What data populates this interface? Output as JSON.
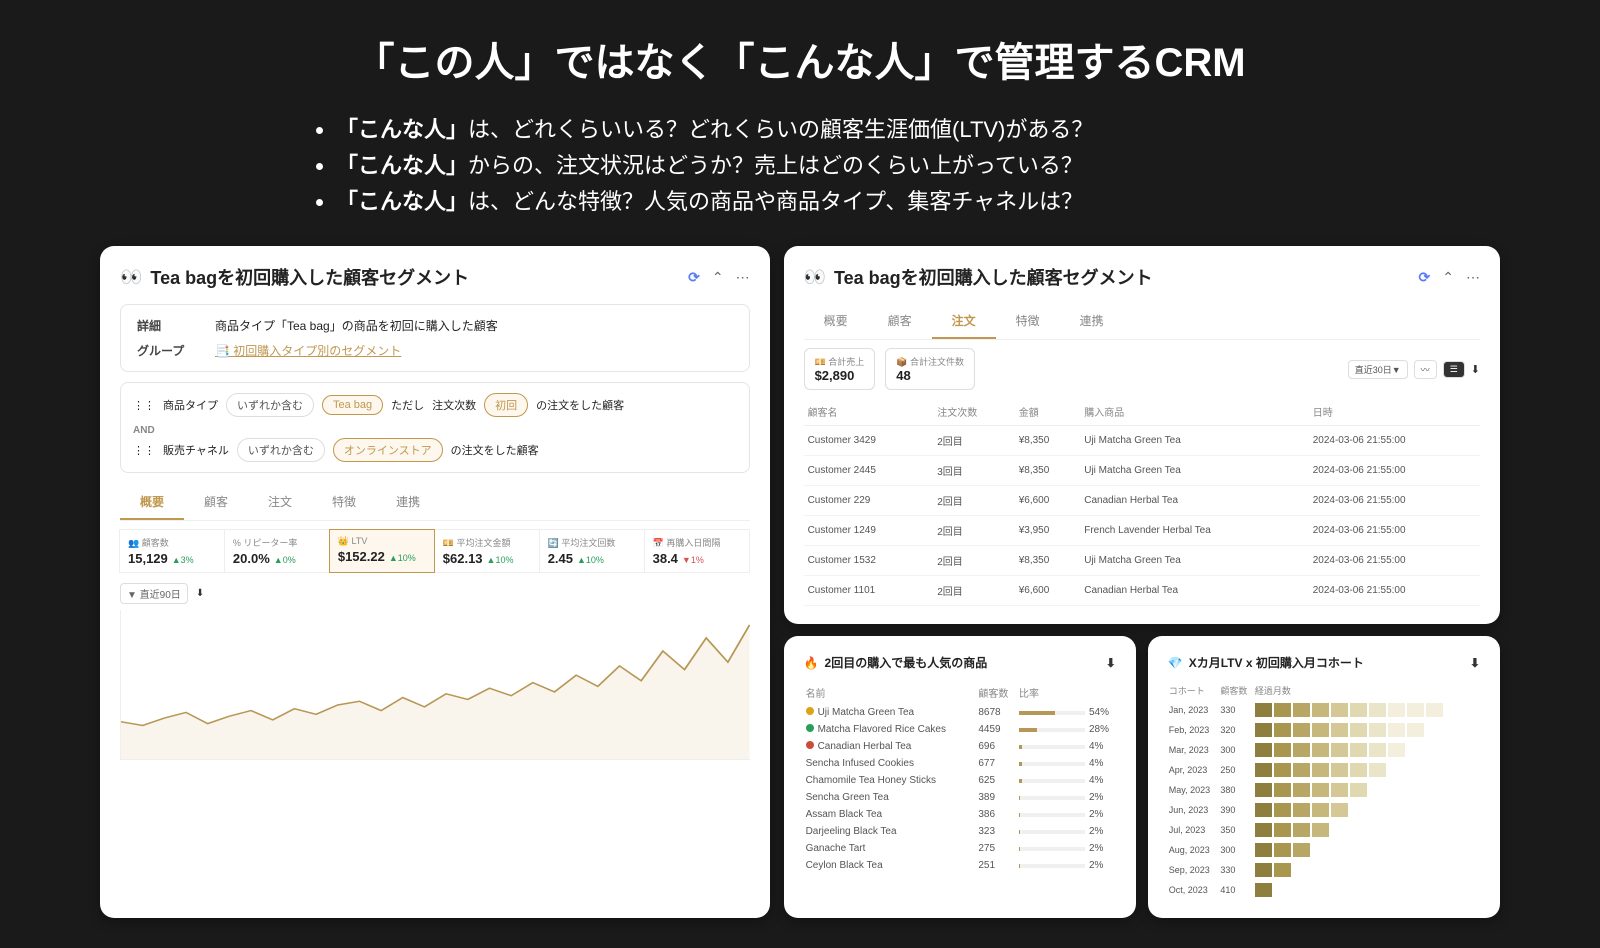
{
  "headline": "「この人」ではなく「こんな人」で管理するCRM",
  "bullets": [
    {
      "bold": "「こんな人」",
      "rest": "は、どれくらいいる？どれくらいの顧客生涯価値(LTV)がある？"
    },
    {
      "bold": "「こんな人」",
      "rest": "からの、注文状況はどうか？売上はどのくらい上がっている？"
    },
    {
      "bold": "「こんな人」",
      "rest": "は、どんな特徴？人気の商品や商品タイプ、集客チャネルは？"
    }
  ],
  "left_card": {
    "title": "Tea bagを初回購入した顧客セグメント",
    "detail_label": "詳細",
    "detail_text": "商品タイプ「Tea bag」の商品を初回に購入した顧客",
    "group_label": "グループ",
    "group_link": "📑 初回購入タイプ別のセグメント",
    "filter1": {
      "pre": "商品タイプ",
      "cond": "いずれか含む",
      "tag": "Tea bag",
      "mid": "ただし",
      "cond2": "注文次数",
      "tag2": "初回",
      "post": "の注文をした顧客"
    },
    "and": "AND",
    "filter2": {
      "pre": "販売チャネル",
      "cond": "いずれか含む",
      "tag": "オンラインストア",
      "post": "の注文をした顧客"
    },
    "tabs": [
      "概要",
      "顧客",
      "注文",
      "特徴",
      "連携"
    ],
    "stats": [
      {
        "label": "👥 顧客数",
        "val": "15,129",
        "delta": "▲3%",
        "cls": "up"
      },
      {
        "label": "% リピーター率",
        "val": "20.0%",
        "delta": "▲0%",
        "cls": "up"
      },
      {
        "label": "👑 LTV",
        "val": "$152.22",
        "delta": "▲10%",
        "cls": "up",
        "hl": true
      },
      {
        "label": "💴 平均注文金額",
        "val": "$62.13",
        "delta": "▲10%",
        "cls": "up"
      },
      {
        "label": "🔄 平均注文回数",
        "val": "2.45",
        "delta": "▲10%",
        "cls": "up"
      },
      {
        "label": "📅 再購入日間隔",
        "val": "38.4",
        "delta": "▼1%",
        "cls": "down"
      }
    ],
    "period": "▼ 直近90日"
  },
  "right_top": {
    "title": "Tea bagを初回購入した顧客セグメント",
    "tabs": [
      "概要",
      "顧客",
      "注文",
      "特徴",
      "連携"
    ],
    "sum1_label": "💴 合計売上",
    "sum1_val": "$2,890",
    "sum2_label": "📦 合計注文件数",
    "sum2_val": "48",
    "period": "直近30日▼",
    "cols": [
      "顧客名",
      "注文次数",
      "金額",
      "購入商品",
      "日時"
    ],
    "rows": [
      [
        "Customer 3429",
        "2回目",
        "¥8,350",
        "Uji Matcha Green Tea",
        "2024-03-06 21:55:00"
      ],
      [
        "Customer 2445",
        "3回目",
        "¥8,350",
        "Uji Matcha Green Tea",
        "2024-03-06 21:55:00"
      ],
      [
        "Customer 229",
        "2回目",
        "¥6,600",
        "Canadian Herbal Tea",
        "2024-03-06 21:55:00"
      ],
      [
        "Customer 1249",
        "2回目",
        "¥3,950",
        "French Lavender Herbal Tea",
        "2024-03-06 21:55:00"
      ],
      [
        "Customer 1532",
        "2回目",
        "¥8,350",
        "Uji Matcha Green Tea",
        "2024-03-06 21:55:00"
      ],
      [
        "Customer 1101",
        "2回目",
        "¥6,600",
        "Canadian Herbal Tea",
        "2024-03-06 21:55:00"
      ]
    ]
  },
  "popular": {
    "title": "2回目の購入で最も人気の商品",
    "cols": [
      "名前",
      "顧客数",
      "比率",
      ""
    ],
    "rows": [
      {
        "dot": "#d9a516",
        "name": "Uji Matcha Green Tea",
        "cnt": "8678",
        "pct": "54%",
        "w": 54
      },
      {
        "dot": "#2a9d5a",
        "name": "Matcha Flavored Rice Cakes",
        "cnt": "4459",
        "pct": "28%",
        "w": 28
      },
      {
        "dot": "#c94d3a",
        "name": "Canadian Herbal Tea",
        "cnt": "696",
        "pct": "4%",
        "w": 4
      },
      {
        "name": "Sencha Infused Cookies",
        "cnt": "677",
        "pct": "4%",
        "w": 4
      },
      {
        "name": "Chamomile Tea Honey Sticks",
        "cnt": "625",
        "pct": "4%",
        "w": 4
      },
      {
        "name": "Sencha Green Tea",
        "cnt": "389",
        "pct": "2%",
        "w": 2
      },
      {
        "name": "Assam Black Tea",
        "cnt": "386",
        "pct": "2%",
        "w": 2
      },
      {
        "name": "Darjeeling Black Tea",
        "cnt": "323",
        "pct": "2%",
        "w": 2
      },
      {
        "name": "Ganache Tart",
        "cnt": "275",
        "pct": "2%",
        "w": 2
      },
      {
        "name": "Ceylon Black Tea",
        "cnt": "251",
        "pct": "2%",
        "w": 2
      }
    ]
  },
  "cohort": {
    "title": "Xカ月LTV x 初回購入月コホート",
    "cols": [
      "コホート",
      "顧客数",
      "経過月数"
    ],
    "rows": [
      {
        "m": "Jan, 2023",
        "c": "330",
        "cells": 10
      },
      {
        "m": "Feb, 2023",
        "c": "320",
        "cells": 9
      },
      {
        "m": "Mar, 2023",
        "c": "300",
        "cells": 8
      },
      {
        "m": "Apr, 2023",
        "c": "250",
        "cells": 7
      },
      {
        "m": "May, 2023",
        "c": "380",
        "cells": 6
      },
      {
        "m": "Jun, 2023",
        "c": "390",
        "cells": 5
      },
      {
        "m": "Jul, 2023",
        "c": "350",
        "cells": 4
      },
      {
        "m": "Aug, 2023",
        "c": "300",
        "cells": 3
      },
      {
        "m": "Sep, 2023",
        "c": "330",
        "cells": 2
      },
      {
        "m": "Oct, 2023",
        "c": "410",
        "cells": 1
      }
    ],
    "shades": [
      "#8f7f3e",
      "#a99750",
      "#b8a764",
      "#c6b87d",
      "#d4c996",
      "#e0d8b0",
      "#eae4c8",
      "#f3efdc"
    ]
  },
  "chart_data": {
    "type": "line",
    "title": "",
    "xlabel": "",
    "ylabel": "",
    "x": [
      0,
      1,
      2,
      3,
      4,
      5,
      6,
      7,
      8,
      9,
      10,
      11,
      12,
      13,
      14,
      15,
      16,
      17,
      18,
      19,
      20,
      21,
      22,
      23,
      24,
      25,
      26,
      27,
      28,
      29
    ],
    "values": [
      20,
      18,
      22,
      25,
      19,
      23,
      26,
      21,
      27,
      24,
      29,
      31,
      26,
      33,
      28,
      35,
      32,
      38,
      34,
      41,
      36,
      45,
      39,
      50,
      42,
      58,
      48,
      65,
      52,
      72
    ],
    "ylim": [
      0,
      80
    ]
  }
}
